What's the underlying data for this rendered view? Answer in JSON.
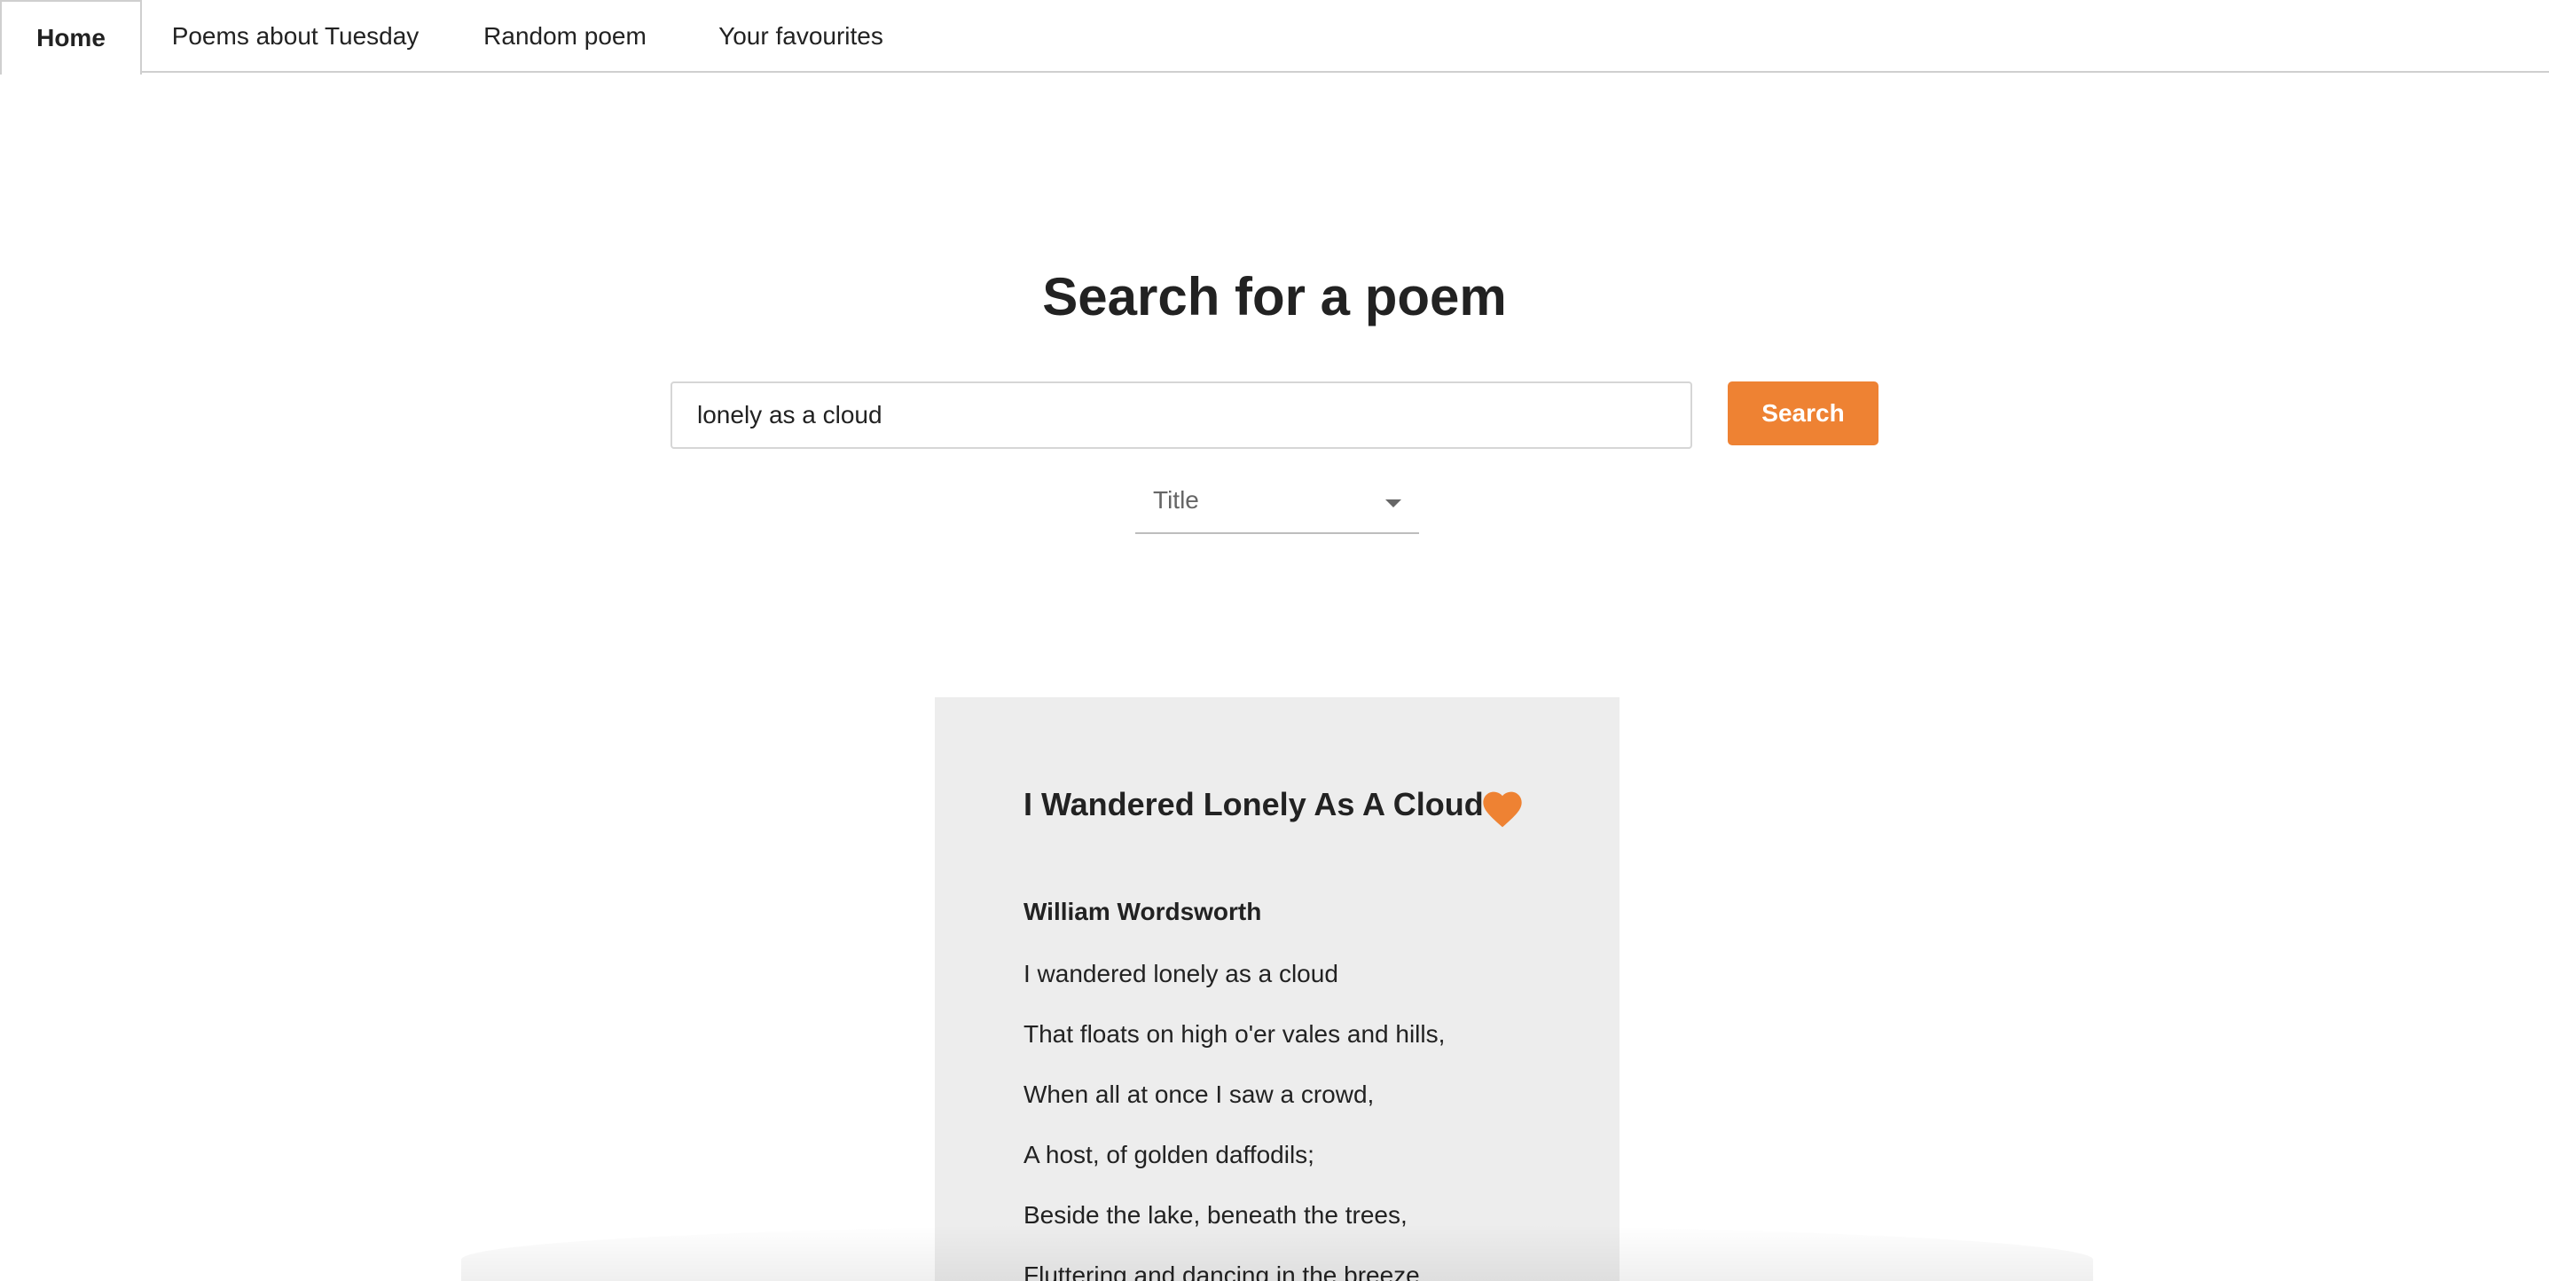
{
  "tabs": [
    {
      "label": "Home"
    },
    {
      "label": "Poems about Tuesday"
    },
    {
      "label": "Random poem"
    },
    {
      "label": "Your favourites"
    }
  ],
  "heading": "Search for a poem",
  "search": {
    "value": "lonely as a cloud",
    "button_label": "Search"
  },
  "filter": {
    "selected": "Title"
  },
  "poem": {
    "title": "I Wandered Lonely As A Cloud",
    "author": "William Wordsworth",
    "lines": [
      "I wandered lonely as a cloud",
      "That floats on high o'er vales and hills,",
      "When all at once I saw a crowd,",
      "A host, of golden daffodils;",
      "Beside the lake, beneath the trees,",
      "Fluttering and dancing in the breeze."
    ],
    "favourite_icon": "heart-icon"
  },
  "colors": {
    "accent": "#ee8233",
    "card_background": "#ededed"
  }
}
